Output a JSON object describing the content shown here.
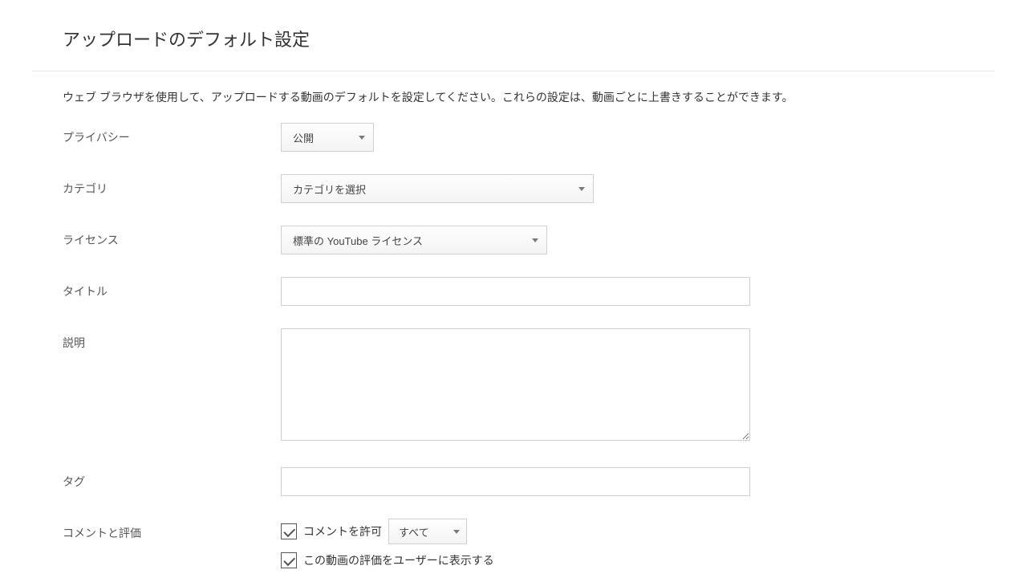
{
  "header": {
    "title": "アップロードのデフォルト設定"
  },
  "description": "ウェブ ブラウザを使用して、アップロードする動画のデフォルトを設定してください。これらの設定は、動画ごとに上書きすることができます。",
  "form": {
    "privacy": {
      "label": "プライバシー",
      "value": "公開"
    },
    "category": {
      "label": "カテゴリ",
      "value": "カテゴリを選択"
    },
    "license": {
      "label": "ライセンス",
      "value": "標準の YouTube ライセンス"
    },
    "title": {
      "label": "タイトル",
      "value": ""
    },
    "desc": {
      "label": "説明",
      "value": ""
    },
    "tags": {
      "label": "タグ",
      "value": ""
    },
    "comments": {
      "label": "コメントと評価",
      "allow_checkbox_label": "コメントを許可",
      "allow_checked": true,
      "filter_value": "すべて",
      "show_ratings_label": "この動画の評価をユーザーに表示する",
      "show_ratings_checked": true
    }
  }
}
